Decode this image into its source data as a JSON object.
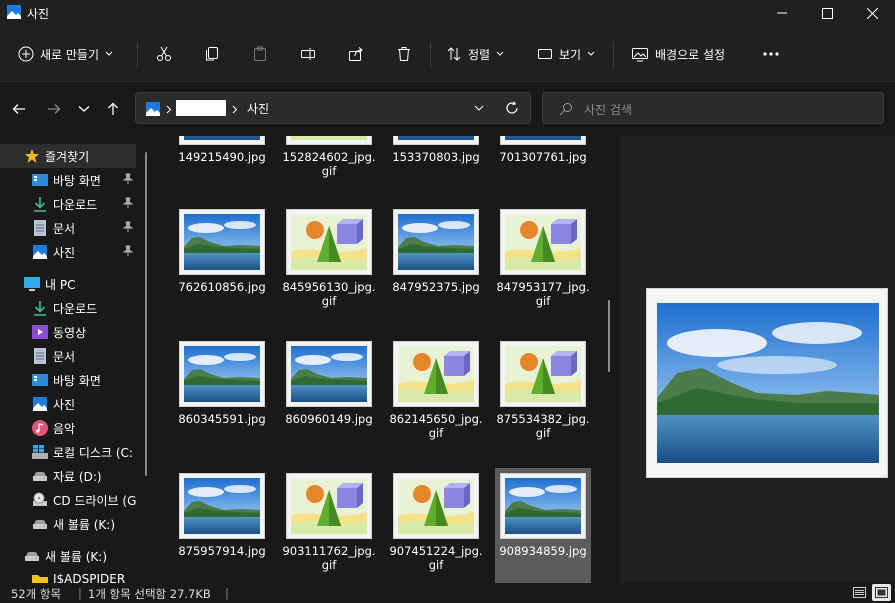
{
  "window": {
    "title": "사진"
  },
  "commands": {
    "new_label": "새로 만들기",
    "sort_label": "정렬",
    "view_label": "보기",
    "background_label": "배경으로 설정"
  },
  "address": {
    "folder": "사진",
    "search_placeholder": "사진 검색"
  },
  "sidebar": {
    "quick_access": "즐겨찾기",
    "quick_items": [
      "바탕 화면",
      "다운로드",
      "문서",
      "사진"
    ],
    "this_pc": "내 PC",
    "pc_items": [
      "다운로드",
      "동영상",
      "문서",
      "바탕 화면",
      "사진",
      "음악",
      "로컬 디스크 (C:",
      "자료 (D:)",
      "CD 드라이브 (G",
      "새 볼륨 (K:)"
    ],
    "extra_items": [
      "새 볼륨 (K:)",
      "I$ADSPIDER"
    ]
  },
  "files": {
    "row0": [
      {
        "name": "149215490.jpg",
        "kind": "landscape"
      },
      {
        "name": "152824602_jpg.\ngif",
        "kind": "shapes"
      },
      {
        "name": "153370803.jpg",
        "kind": "landscape"
      },
      {
        "name": "701307761.jpg",
        "kind": "landscape"
      }
    ],
    "grid": [
      {
        "name": "762610856.jpg",
        "kind": "landscape"
      },
      {
        "name": "845956130_jpg.\ngif",
        "kind": "shapes"
      },
      {
        "name": "847952375.jpg",
        "kind": "landscape"
      },
      {
        "name": "847953177_jpg.\ngif",
        "kind": "shapes"
      },
      {
        "name": "860345591.jpg",
        "kind": "landscape"
      },
      {
        "name": "860960149.jpg",
        "kind": "landscape"
      },
      {
        "name": "862145650_jpg.\ngif",
        "kind": "shapes"
      },
      {
        "name": "875534382_jpg.\ngif",
        "kind": "shapes"
      },
      {
        "name": "875957914.jpg",
        "kind": "landscape"
      },
      {
        "name": "903111762_jpg.\ngif",
        "kind": "shapes"
      },
      {
        "name": "907451224_jpg.\ngif",
        "kind": "shapes"
      },
      {
        "name": "908934859.jpg",
        "kind": "landscape",
        "selected": true
      }
    ]
  },
  "status": {
    "count": "52개 항목",
    "selection": "1개 항목 선택함 27.7KB"
  },
  "colors": {
    "accent": "#0a6fd6",
    "selected_tile": "#5c5c5c",
    "folder_yellow": "#f0c419"
  }
}
